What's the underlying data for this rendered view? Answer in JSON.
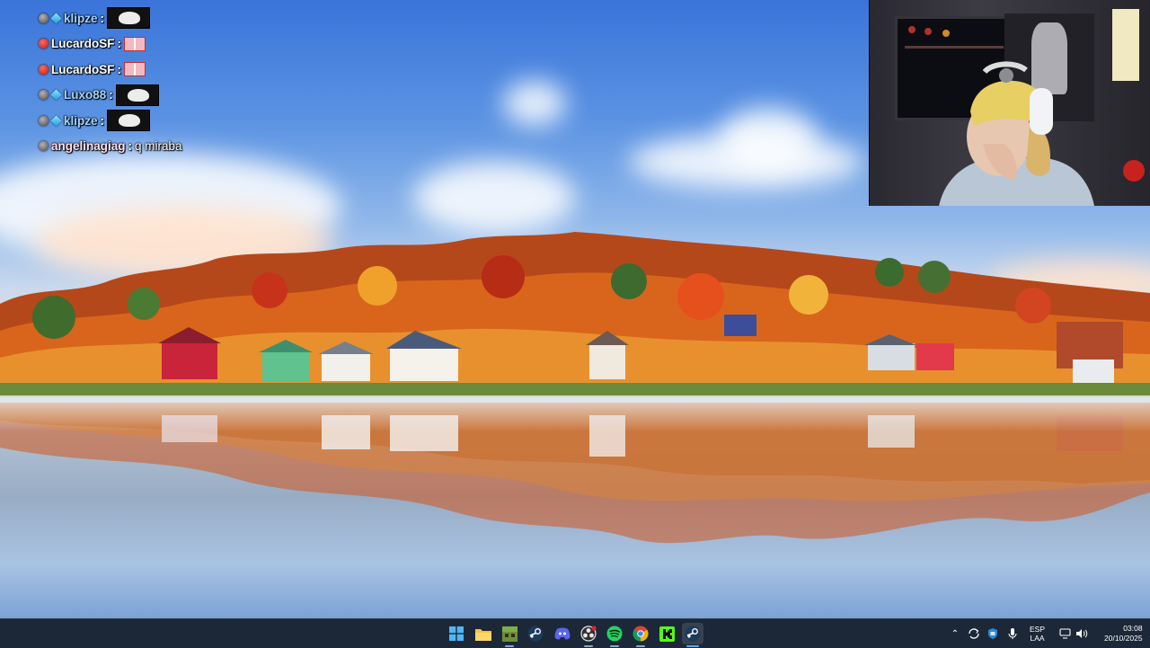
{
  "chat": {
    "lines": [
      {
        "badges": [
          "gray-circle",
          "cube"
        ],
        "username": "klipze",
        "user_color": "#9fd3ff",
        "message": "",
        "emote": "ghost-emote"
      },
      {
        "badges": [
          "red-circle"
        ],
        "username": "LucardoSF",
        "user_color": "#ffffff",
        "message": "",
        "emote": "cat-emote"
      },
      {
        "badges": [
          "red-circle"
        ],
        "username": "LucardoSF",
        "user_color": "#ffffff",
        "message": "",
        "emote": "cat-emote"
      },
      {
        "badges": [
          "gray-circle",
          "cube"
        ],
        "username": "Luxo88",
        "user_color": "#9fd3ff",
        "message": "",
        "emote": "ghost-emote"
      },
      {
        "badges": [
          "gray-circle",
          "cube"
        ],
        "username": "klipze",
        "user_color": "#9fd3ff",
        "message": "",
        "emote": "ghost-emote"
      },
      {
        "badges": [
          "gray-circle"
        ],
        "username": "angelinagiag",
        "user_color": "#ffe2ec",
        "message": "q miraba",
        "emote": ""
      }
    ]
  },
  "taskbar": {
    "apps": [
      "start-icon",
      "file-explorer-icon",
      "minecraft-icon",
      "steam-icon",
      "discord-icon",
      "obs-icon",
      "spotify-icon",
      "chrome-icon",
      "kick-icon",
      "steam-active-icon"
    ],
    "tray": {
      "language_top": "ESP",
      "language_bottom": "LAA",
      "time": "03:08",
      "date": "20/10/2025"
    }
  },
  "colors": {
    "taskbar_bg": "#1c2838",
    "accent": "#5aa9ff"
  }
}
